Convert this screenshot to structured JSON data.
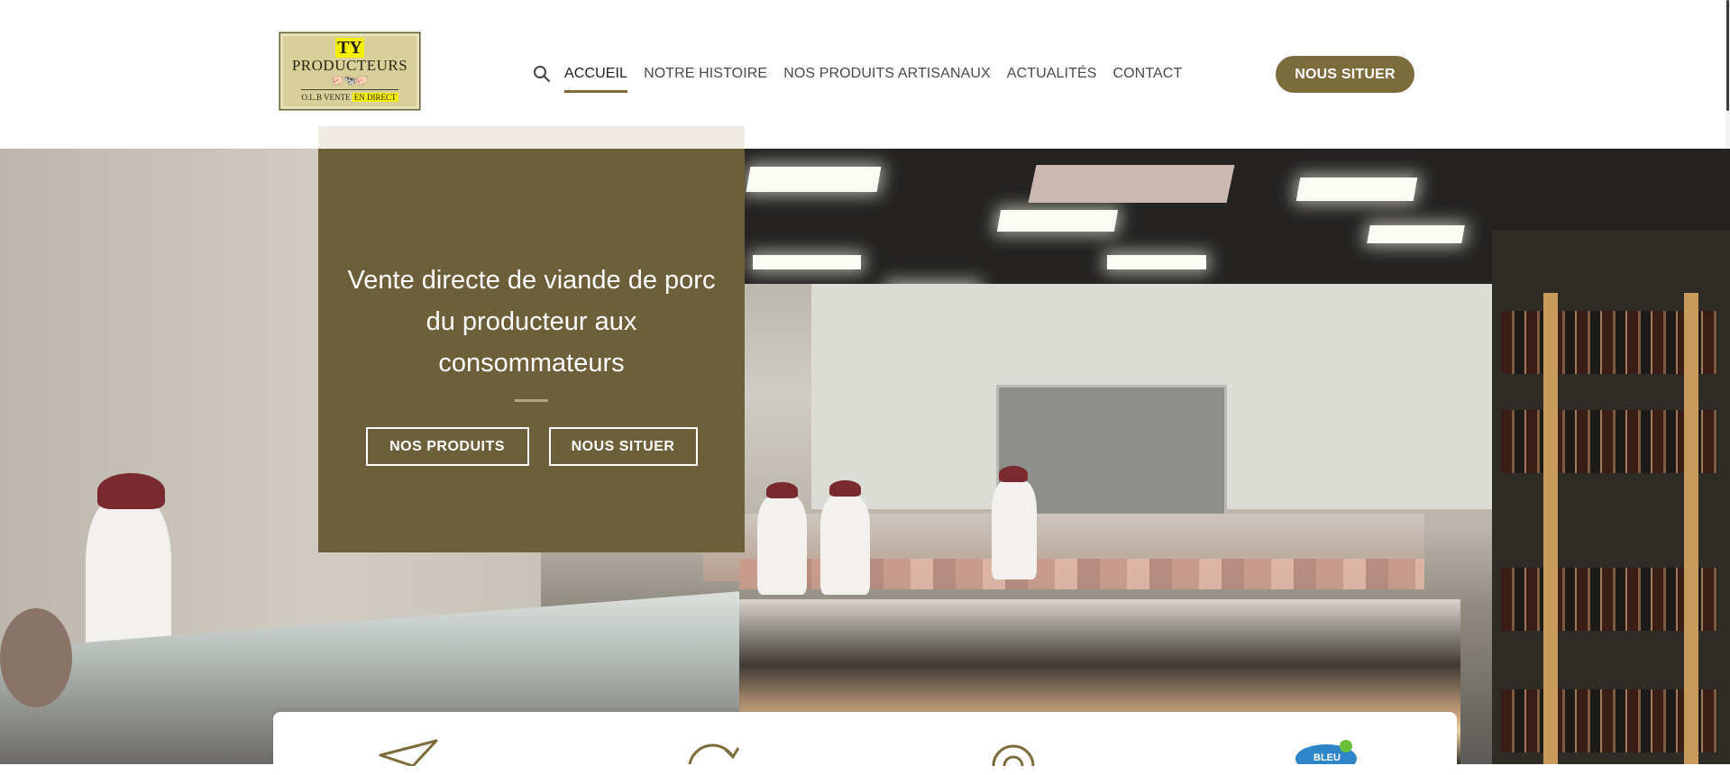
{
  "header": {
    "logo": {
      "line1": "TY",
      "line2": "PRODUCTEURS",
      "line3_prefix": "O.L.B VENTE ",
      "line3_highlight": "EN DIRECT"
    },
    "search_icon": "search-icon",
    "nav": [
      {
        "label": "ACCUEIL",
        "active": true
      },
      {
        "label": "NOTRE HISTOIRE",
        "active": false
      },
      {
        "label": "NOS PRODUITS ARTISANAUX",
        "active": false
      },
      {
        "label": "ACTUALITÉS",
        "active": false
      },
      {
        "label": "CONTACT",
        "active": false
      }
    ],
    "cta_label": "NOUS SITUER"
  },
  "hero": {
    "title": "Vente directe de viande de porc du producteur aux consommateurs",
    "button_products": "NOS PRODUITS",
    "button_locate": "NOUS SITUER"
  },
  "features": {
    "icons": [
      "paper-plane-icon",
      "refresh-icon",
      "gear-icon",
      "bleu-blanc-coeur-badge"
    ],
    "badge_text": "BLEU"
  },
  "colors": {
    "accent": "#7d6c3b",
    "overlay": "#6d5f39"
  }
}
